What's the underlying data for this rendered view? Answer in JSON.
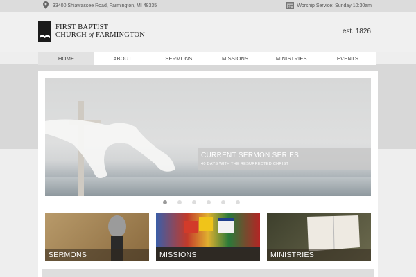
{
  "topbar": {
    "address": "33400 Shiawassee Road, Farmington, MI 48335",
    "service": "Worship Service: Sunday 10:30am",
    "location_icon": "map-pin-icon",
    "calendar_icon": "calendar-icon"
  },
  "logo": {
    "line1": "FIRST BAPTIST",
    "line2_a": "CHURCH ",
    "line2_of": "of",
    "line2_b": " FARMINGTON"
  },
  "est": "est. 1826",
  "nav": {
    "items": [
      "HOME",
      "ABOUT",
      "SERMONS",
      "MISSIONS",
      "MINISTRIES",
      "EVENTS"
    ],
    "active": "HOME"
  },
  "slider": {
    "caption_title": "CURRENT SERMON SERIES",
    "caption_subtitle": "40 DAYS WITH THE RESURRECTED CHRIST",
    "slide_count": 6,
    "active_slide": 1
  },
  "tiles": {
    "sermons": "SERMONS",
    "missions": "MISSIONS",
    "ministries": "MINISTRIES"
  },
  "colors": {
    "nav_active_bg": "#e2e2e2",
    "logo_dark": "#1b1b1b"
  }
}
